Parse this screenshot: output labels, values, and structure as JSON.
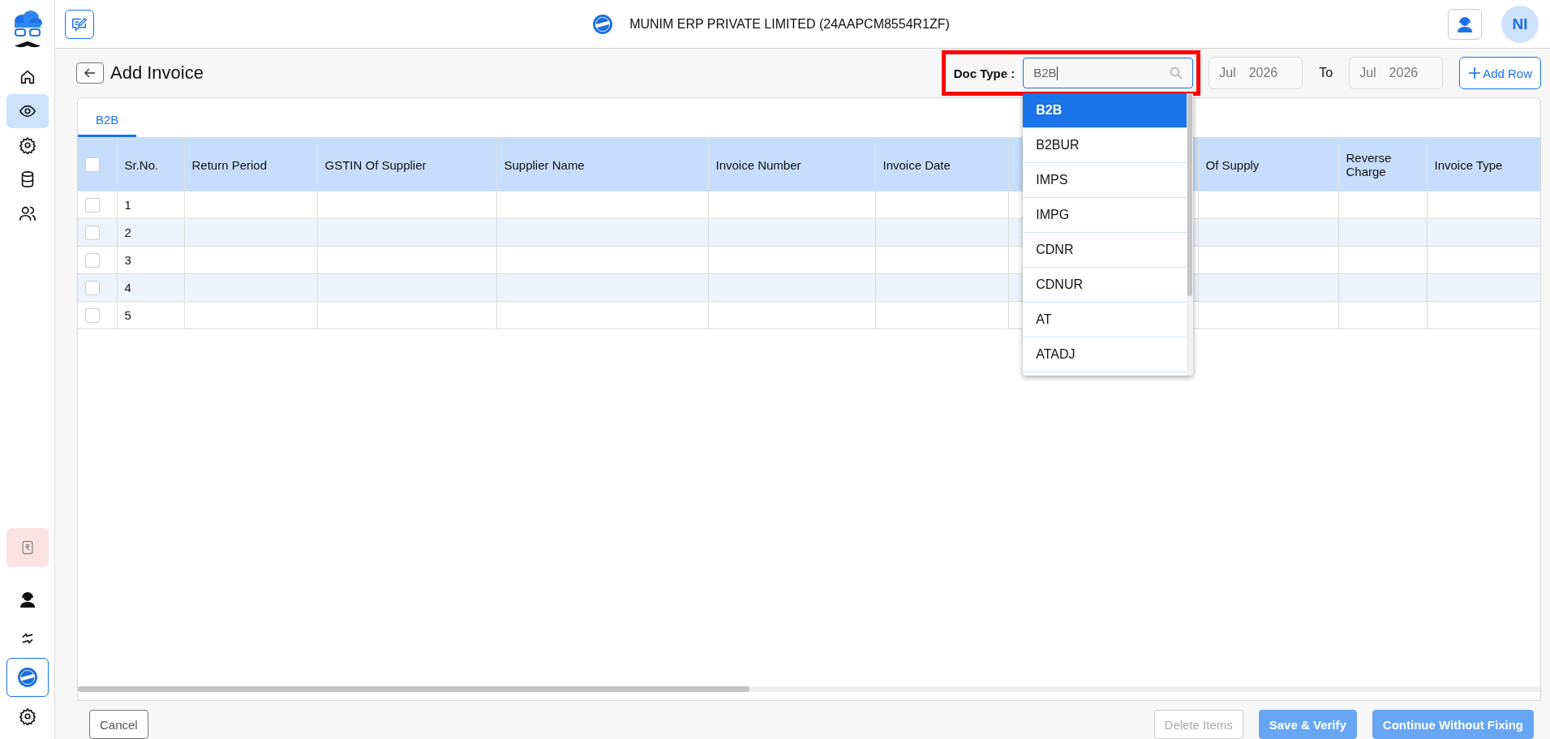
{
  "sidebar": {
    "items": [
      {
        "selected": false
      },
      {
        "selected": true
      },
      {
        "selected": false
      },
      {
        "selected": false
      },
      {
        "selected": false
      }
    ],
    "bottom_items": [
      {
        "selected": false
      },
      {
        "selected": false
      },
      {
        "selected": false
      },
      {
        "selected": false
      },
      {
        "selected": false
      }
    ]
  },
  "header": {
    "company": "MUNIM ERP PRIVATE LIMITED (24AAPCM8554R1ZF)",
    "avatar": "NI"
  },
  "page": {
    "title": "Add Invoice"
  },
  "filters": {
    "doc_type_label": "Doc Type :",
    "doc_type_value": "B2B",
    "from": {
      "month": "Jul",
      "year": "2026"
    },
    "to_label": "To",
    "to": {
      "month": "Jul",
      "year": "2026"
    },
    "add_row": "Add Row"
  },
  "dropdown": {
    "options": [
      {
        "label": "B2B",
        "selected": true
      },
      {
        "label": "B2BUR",
        "selected": false
      },
      {
        "label": "IMPS",
        "selected": false
      },
      {
        "label": "IMPG",
        "selected": false
      },
      {
        "label": "CDNR",
        "selected": false
      },
      {
        "label": "CDNUR",
        "selected": false
      },
      {
        "label": "AT",
        "selected": false
      },
      {
        "label": "ATADJ",
        "selected": false
      }
    ]
  },
  "tabs": [
    {
      "label": "B2B",
      "selected": true
    }
  ],
  "table": {
    "header_checked": false,
    "columns": [
      "Sr.No.",
      "Return Period",
      "GSTIN Of Supplier",
      "Supplier Name",
      "Invoice Number",
      "Invoice Date",
      "",
      "Of Supply",
      "Reverse Charge",
      "Invoice Type"
    ],
    "rows": [
      {
        "checked": false,
        "sr": "1"
      },
      {
        "checked": false,
        "sr": "2"
      },
      {
        "checked": false,
        "sr": "3"
      },
      {
        "checked": false,
        "sr": "4"
      },
      {
        "checked": false,
        "sr": "5"
      }
    ]
  },
  "footer": {
    "buttons": [
      {
        "label": "Cancel",
        "kind": "outline",
        "disabled": false
      },
      {
        "label": "Delete Items",
        "kind": "outline",
        "disabled": true
      },
      {
        "label": "Save & Verify",
        "kind": "primary",
        "disabled": true
      },
      {
        "label": "Continue Without Fixing",
        "kind": "primary",
        "disabled": true
      }
    ]
  }
}
